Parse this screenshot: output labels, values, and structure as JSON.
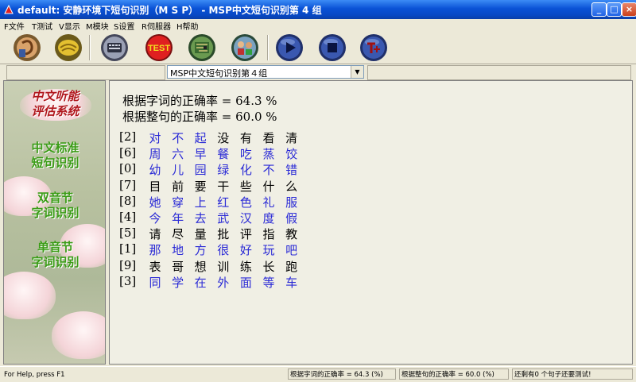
{
  "window": {
    "title": "default: 安静环境下短句识别（M S P） - MSP中文短句识别第 4 组",
    "minimize_label": "_",
    "maximize_label": "□",
    "close_label": "×"
  },
  "menu": [
    {
      "label": "F文件"
    },
    {
      "label": "T测试"
    },
    {
      "label": "V显示"
    },
    {
      "label": "M模块"
    },
    {
      "label": "S设置"
    },
    {
      "label": "R伺服器"
    },
    {
      "label": "H帮助"
    }
  ],
  "toolbar": {
    "test_label": "TEST",
    "icons": [
      "ear-icon",
      "brain-icon",
      "keyboard-icon",
      "test-icon",
      "circuit-icon",
      "people-icon",
      "play-icon",
      "stop-icon",
      "t-plus-icon"
    ]
  },
  "combo": {
    "selected": "MSP中文短句识别第４组",
    "arrow": "▼"
  },
  "sidebar": {
    "title_line1": "中文听能",
    "title_line2": "评估系统",
    "item1_line1": "中文标准",
    "item1_line2": "短句识别",
    "item2_line1": "双音节",
    "item2_line2": "字词识别",
    "item3_line1": "单音节",
    "item3_line2": "字词识别"
  },
  "results": {
    "word_accuracy": "根据字词的正确率 = 64.3 %",
    "sentence_accuracy": "根据整句的正确率 = 60.0 %"
  },
  "sentences": [
    {
      "index": "[2]",
      "chars": [
        {
          "c": "对",
          "ok": true
        },
        {
          "c": "不",
          "ok": true
        },
        {
          "c": "起",
          "ok": true
        },
        {
          "c": "没",
          "ok": false
        },
        {
          "c": "有",
          "ok": false
        },
        {
          "c": "看",
          "ok": false
        },
        {
          "c": "清",
          "ok": false
        }
      ]
    },
    {
      "index": "[6]",
      "chars": [
        {
          "c": "周",
          "ok": true
        },
        {
          "c": "六",
          "ok": true
        },
        {
          "c": "早",
          "ok": true
        },
        {
          "c": "餐",
          "ok": true
        },
        {
          "c": "吃",
          "ok": true
        },
        {
          "c": "蒸",
          "ok": true
        },
        {
          "c": "饺",
          "ok": true
        }
      ]
    },
    {
      "index": "[0]",
      "chars": [
        {
          "c": "幼",
          "ok": true
        },
        {
          "c": "儿",
          "ok": true
        },
        {
          "c": "园",
          "ok": true
        },
        {
          "c": "绿",
          "ok": true
        },
        {
          "c": "化",
          "ok": true
        },
        {
          "c": "不",
          "ok": true
        },
        {
          "c": "错",
          "ok": true
        }
      ]
    },
    {
      "index": "[7]",
      "chars": [
        {
          "c": "目",
          "ok": false
        },
        {
          "c": "前",
          "ok": false
        },
        {
          "c": "要",
          "ok": false
        },
        {
          "c": "干",
          "ok": false
        },
        {
          "c": "些",
          "ok": false
        },
        {
          "c": "什",
          "ok": false
        },
        {
          "c": "么",
          "ok": false
        }
      ]
    },
    {
      "index": "[8]",
      "chars": [
        {
          "c": "她",
          "ok": true
        },
        {
          "c": "穿",
          "ok": true
        },
        {
          "c": "上",
          "ok": true
        },
        {
          "c": "红",
          "ok": true
        },
        {
          "c": "色",
          "ok": true
        },
        {
          "c": "礼",
          "ok": true
        },
        {
          "c": "服",
          "ok": true
        }
      ]
    },
    {
      "index": "[4]",
      "chars": [
        {
          "c": "今",
          "ok": true
        },
        {
          "c": "年",
          "ok": true
        },
        {
          "c": "去",
          "ok": true
        },
        {
          "c": "武",
          "ok": true
        },
        {
          "c": "汉",
          "ok": true
        },
        {
          "c": "度",
          "ok": true
        },
        {
          "c": "假",
          "ok": true
        }
      ]
    },
    {
      "index": "[5]",
      "chars": [
        {
          "c": "请",
          "ok": false
        },
        {
          "c": "尽",
          "ok": false
        },
        {
          "c": "量",
          "ok": false
        },
        {
          "c": "批",
          "ok": false
        },
        {
          "c": "评",
          "ok": false
        },
        {
          "c": "指",
          "ok": false
        },
        {
          "c": "教",
          "ok": false
        }
      ]
    },
    {
      "index": "[1]",
      "chars": [
        {
          "c": "那",
          "ok": true
        },
        {
          "c": "地",
          "ok": true
        },
        {
          "c": "方",
          "ok": true
        },
        {
          "c": "很",
          "ok": true
        },
        {
          "c": "好",
          "ok": true
        },
        {
          "c": "玩",
          "ok": true
        },
        {
          "c": "吧",
          "ok": true
        }
      ]
    },
    {
      "index": "[9]",
      "chars": [
        {
          "c": "表",
          "ok": false
        },
        {
          "c": "哥",
          "ok": false
        },
        {
          "c": "想",
          "ok": false
        },
        {
          "c": "训",
          "ok": false
        },
        {
          "c": "练",
          "ok": false
        },
        {
          "c": "长",
          "ok": false
        },
        {
          "c": "跑",
          "ok": false
        }
      ]
    },
    {
      "index": "[3]",
      "chars": [
        {
          "c": "同",
          "ok": true
        },
        {
          "c": "学",
          "ok": true
        },
        {
          "c": "在",
          "ok": true
        },
        {
          "c": "外",
          "ok": true
        },
        {
          "c": "面",
          "ok": true
        },
        {
          "c": "等",
          "ok": true
        },
        {
          "c": "车",
          "ok": true
        }
      ]
    }
  ],
  "colors": {
    "correct": "#2a2ad6",
    "wrong": "#000000"
  },
  "statusbar": {
    "help": "For Help, press F1",
    "word_accuracy": "根据字词的正确率 = 64.3 (%)",
    "sentence_accuracy": "根据整句的正确率 = 60.0 (%)",
    "remaining": "还剩有0 个句子还要测试!"
  }
}
